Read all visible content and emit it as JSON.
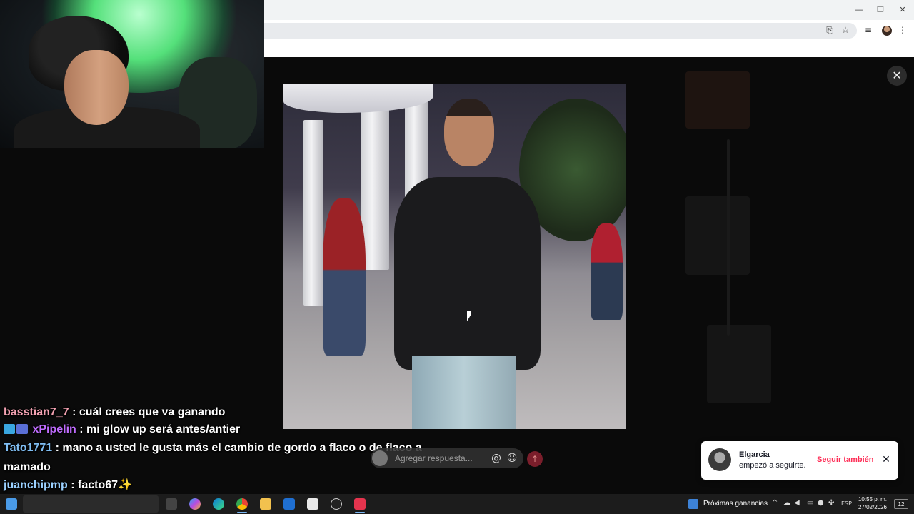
{
  "browser": {
    "window_controls": {
      "minimize": "—",
      "restore": "❐",
      "close": "✕"
    },
    "icons": [
      "install-icon",
      "bookmark-star-icon",
      "media-icon",
      "profile-avatar",
      "menu-icon"
    ]
  },
  "viewer": {
    "close_label": "✕"
  },
  "chat": {
    "messages": [
      {
        "user": "basstian7_7",
        "text": ": cuál crees que va ganando",
        "user_color": "#f5a3b3"
      },
      {
        "user": "xPipelin",
        "text": ": mi glow up será antes/antier",
        "user_color": "#c06cff"
      },
      {
        "user": "Tato1771",
        "text": ": mano a usted le gusta más el cambio de gordo a flaco o de flaco a mamado",
        "user_color": "#7fbdf2"
      },
      {
        "user": "juanchipmp",
        "text": ": facto67✨",
        "user_color": "#9ad0ff"
      }
    ]
  },
  "reply": {
    "placeholder": "Agregar respuesta...",
    "mention_icon": "@",
    "emoji_icon": "☺",
    "send_icon": "↑"
  },
  "toast": {
    "name": "Elgarcia",
    "text": "empezó a seguirte.",
    "follow_label": "Seguir también",
    "close_label": "✕"
  },
  "taskbar": {
    "widget_label": "Próximas ganancias",
    "language": "ESP",
    "time": "10:55 p. m.",
    "date": "27/02/2026",
    "notification_count": "12"
  },
  "colors": {
    "accent": "#fe2c55",
    "glow": "#54e07a"
  }
}
